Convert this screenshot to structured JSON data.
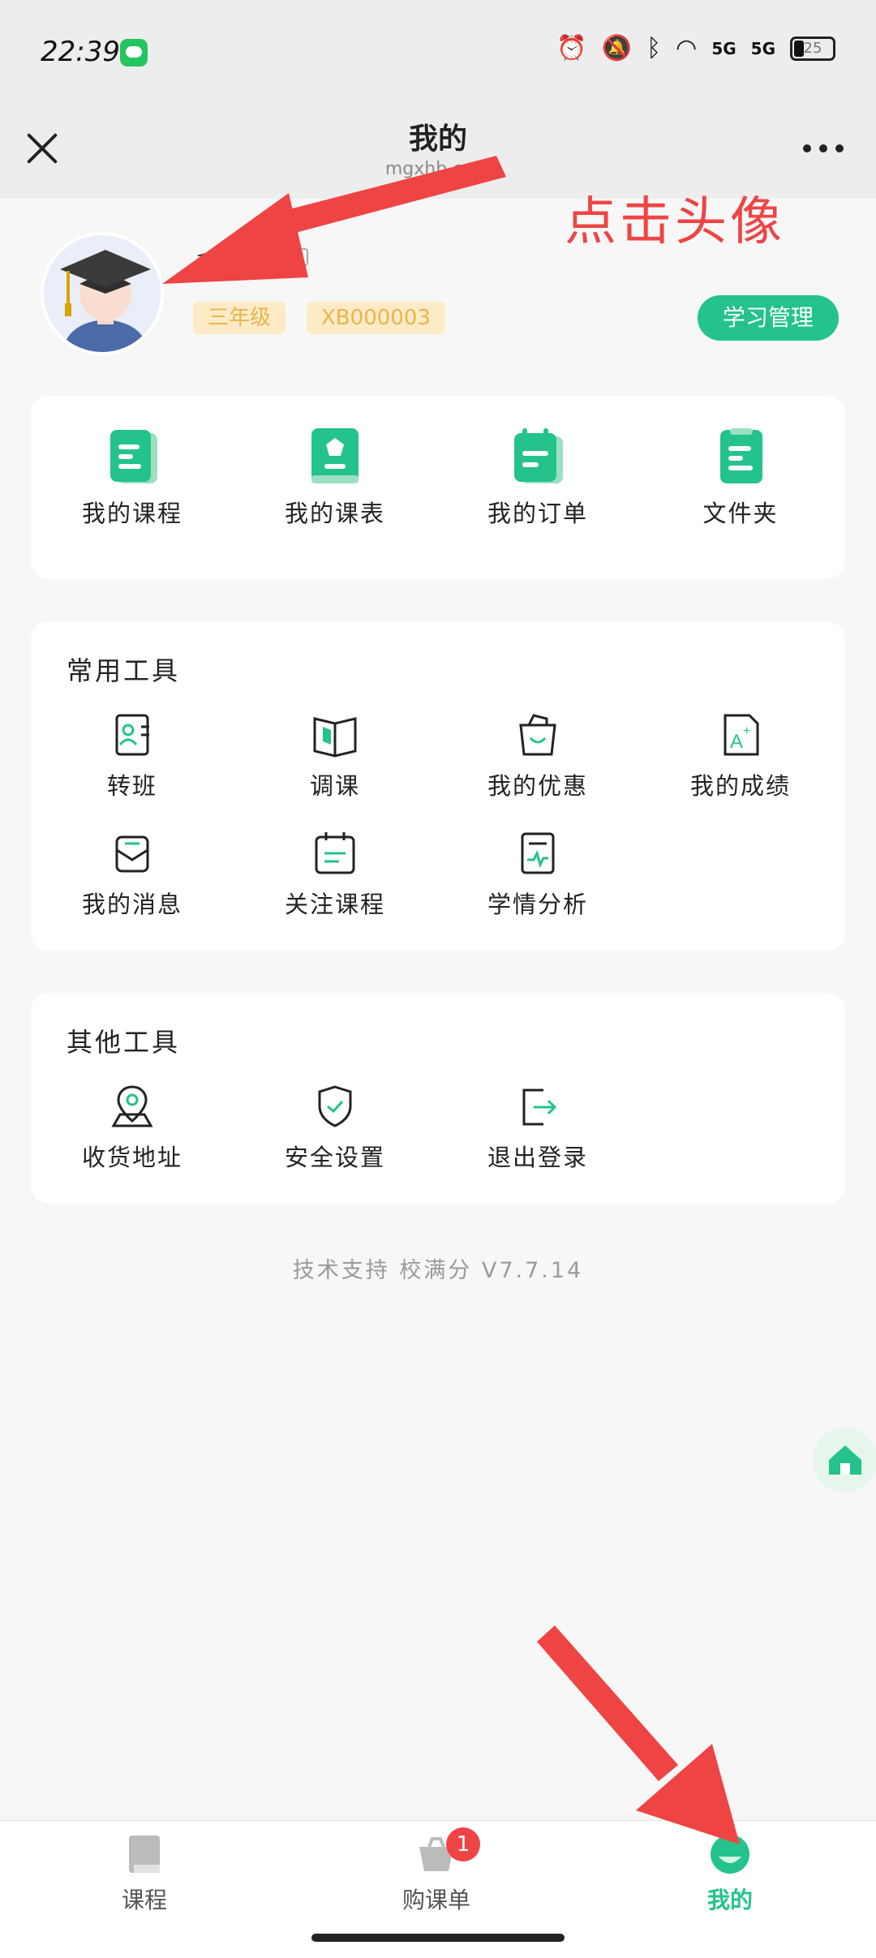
{
  "status_bar": {
    "time": "22:39",
    "battery": "25",
    "signal_labels": [
      "5G",
      "5G"
    ]
  },
  "header": {
    "title": "我的",
    "subtitle": "mgxhb.com",
    "close_icon": "close-icon",
    "more_icon": "more-dots-icon"
  },
  "annotation": {
    "text": "点击头像",
    "color": "#ef4444"
  },
  "profile": {
    "name": "科",
    "grade": "三年级",
    "student_id": "XB000003",
    "study_button": "学习管理"
  },
  "quick_links": [
    {
      "label": "我的课程",
      "icon": "document-icon"
    },
    {
      "label": "我的课表",
      "icon": "schedule-book-icon"
    },
    {
      "label": "我的订单",
      "icon": "order-notepad-icon"
    },
    {
      "label": "文件夹",
      "icon": "folder-document-icon"
    }
  ],
  "common_tools": {
    "title": "常用工具",
    "items": [
      {
        "label": "转班",
        "icon": "contact-card-icon"
      },
      {
        "label": "调课",
        "icon": "open-book-icon"
      },
      {
        "label": "我的优惠",
        "icon": "shopping-bag-icon"
      },
      {
        "label": "我的成绩",
        "icon": "grade-file-icon"
      },
      {
        "label": "我的消息",
        "icon": "mail-icon"
      },
      {
        "label": "关注课程",
        "icon": "calendar-icon"
      },
      {
        "label": "学情分析",
        "icon": "analysis-icon"
      }
    ]
  },
  "other_tools": {
    "title": "其他工具",
    "items": [
      {
        "label": "收货地址",
        "icon": "location-pin-icon"
      },
      {
        "label": "安全设置",
        "icon": "shield-check-icon"
      },
      {
        "label": "退出登录",
        "icon": "logout-icon"
      }
    ]
  },
  "footer": {
    "version": "技术支持 校满分 V7.7.14"
  },
  "bottom_nav": {
    "items": [
      {
        "label": "课程",
        "icon": "book-icon",
        "active": false
      },
      {
        "label": "购课单",
        "icon": "basket-icon",
        "badge": "1",
        "active": false
      },
      {
        "label": "我的",
        "icon": "profile-icon",
        "active": true
      }
    ]
  },
  "colors": {
    "accent": "#23c38b",
    "annotation": "#ef4444",
    "tag_bg": "#fdebc8",
    "tag_text": "#eab54a"
  }
}
